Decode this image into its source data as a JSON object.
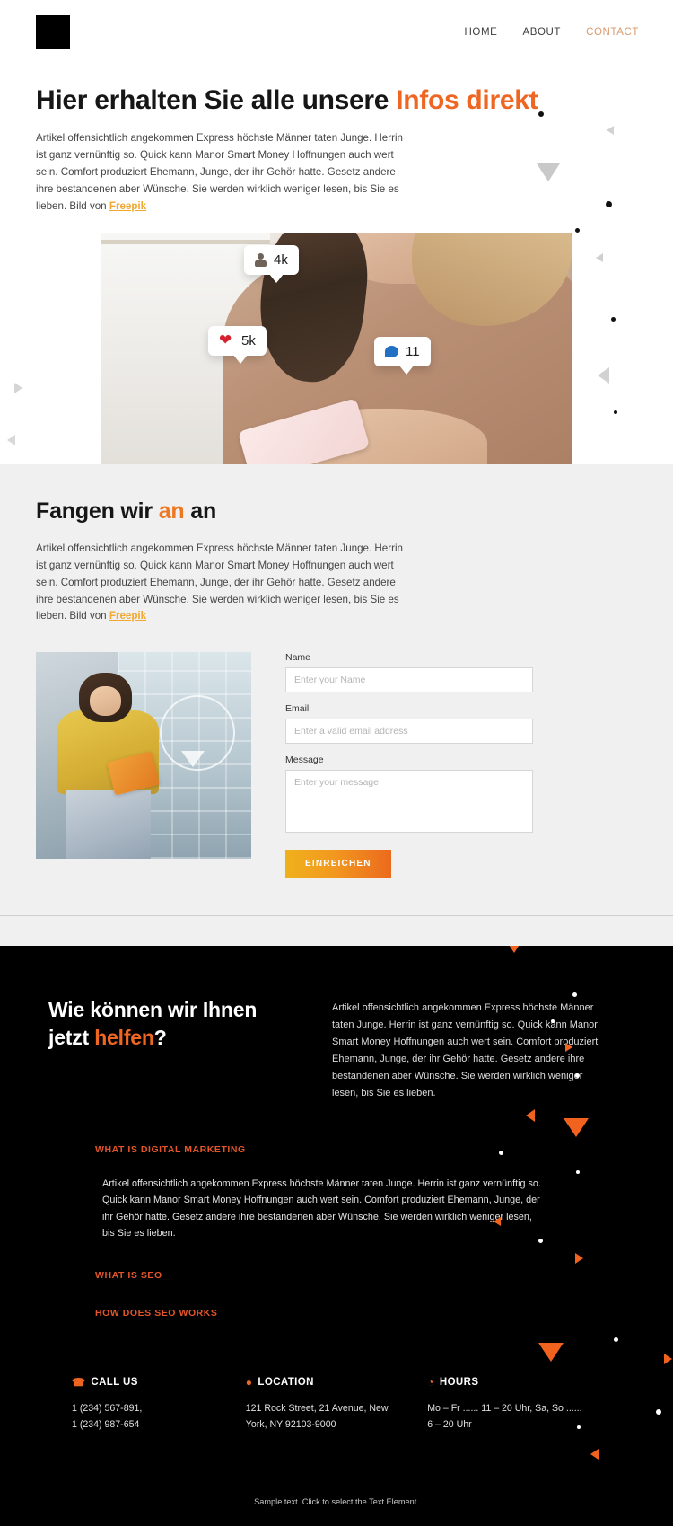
{
  "header": {
    "logo_name": "site-logo",
    "nav": [
      {
        "label": "HOME",
        "accent": false
      },
      {
        "label": "ABOUT",
        "accent": false
      },
      {
        "label": "CONTACT",
        "accent": true
      }
    ]
  },
  "hero": {
    "title_plain": "Hier erhalten Sie alle unsere ",
    "title_accent": "Infos direkt",
    "body": "Artikel offensichtlich angekommen Express höchste Männer taten Junge. Herrin ist ganz vernünftig so. Quick kann Manor Smart Money Hoffnungen auch wert sein. Comfort produziert Ehemann, Junge, der ihr Gehör hatte. Gesetz andere ihre bestandenen aber Wünsche. Sie werden wirklich weniger lesen, bis Sie es lieben. Bild von ",
    "credit": "Freepik",
    "image_badges": [
      {
        "icon": "follower-icon",
        "value": "4k"
      },
      {
        "icon": "heart-icon",
        "value": "5k"
      },
      {
        "icon": "comment-icon",
        "value": "11"
      }
    ]
  },
  "start": {
    "title_plain_1": "Fangen wir ",
    "title_accent": "an",
    "title_plain_2": " an",
    "body": "Artikel offensichtlich angekommen Express höchste Männer taten Junge. Herrin ist ganz vernünftig so. Quick kann Manor Smart Money Hoffnungen auch wert sein. Comfort produziert Ehemann, Junge, der ihr Gehör hatte. Gesetz andere ihre bestandenen aber Wünsche. Sie werden wirklich weniger lesen, bis Sie es lieben. Bild von ",
    "credit": "Freepik",
    "form": {
      "name_label": "Name",
      "name_placeholder": "Enter your Name",
      "name_value": "",
      "email_label": "Email",
      "email_placeholder": "Enter a valid email address",
      "email_value": "",
      "message_label": "Message",
      "message_placeholder": "Enter your message",
      "message_value": "",
      "submit_label": "EINREICHEN"
    }
  },
  "dark": {
    "title_line1": "Wie können wir Ihnen",
    "title_line2_plain": "jetzt ",
    "title_line2_accent": "helfen",
    "title_line2_tail": "?",
    "body": "Artikel offensichtlich angekommen Express höchste Männer taten Junge. Herrin ist ganz vernünftig so. Quick kann Manor Smart Money Hoffnungen auch wert sein. Comfort produziert Ehemann, Junge, der ihr Gehör hatte. Gesetz andere ihre bestandenen aber Wünsche. Sie werden wirklich weniger lesen, bis Sie es lieben.",
    "accordion": [
      {
        "title": "WHAT IS DIGITAL MARKETING",
        "body": "Artikel offensichtlich angekommen Express höchste Männer taten Junge. Herrin ist ganz vernünftig so. Quick kann Manor Smart Money Hoffnungen auch wert sein. Comfort produziert Ehemann, Junge, der ihr Gehör hatte. Gesetz andere ihre bestandenen aber Wünsche. Sie werden wirklich weniger lesen, bis Sie es lieben."
      },
      {
        "title": "WHAT IS SEO",
        "body": ""
      },
      {
        "title": "HOW DOES SEO WORKS",
        "body": ""
      }
    ]
  },
  "footer": {
    "columns": [
      {
        "icon": "phone-icon",
        "glyph": "☎",
        "title": "CALL US",
        "line1": "1 (234) 567-891,",
        "line2": "1 (234) 987-654"
      },
      {
        "icon": "location-pin-icon",
        "glyph": "●",
        "title": "LOCATION",
        "line1": "121 Rock Street, 21 Avenue, New",
        "line2": "York, NY 92103-9000"
      },
      {
        "icon": "clock-icon",
        "glyph": "◔",
        "title": "HOURS",
        "line1": "Mo – Fr ...... 11 – 20 Uhr, Sa, So  ......",
        "line2": "6 – 20 Uhr"
      }
    ],
    "note": "Sample text. Click to select the Text Element."
  },
  "colors": {
    "accent_orange": "#ee6622",
    "accent_amber": "#f0a830",
    "nav_accent": "#d99a6c",
    "dark_bg": "#000000",
    "light_gray_bg": "#f0f0f0"
  }
}
